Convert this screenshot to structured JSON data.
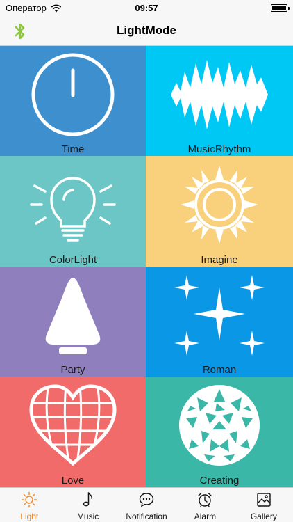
{
  "status_bar": {
    "carrier": "Оператор",
    "time": "09:57"
  },
  "nav": {
    "title": "LightMode",
    "bluetooth_color": "#8cc63f"
  },
  "modes": [
    {
      "label": "Time",
      "icon": "clock-icon",
      "color": "#3d8fce"
    },
    {
      "label": "MusicRhythm",
      "icon": "sound-wave-icon",
      "color": "#00c8f4"
    },
    {
      "label": "ColorLight",
      "icon": "light-bulb-icon",
      "color": "#6cc6c6"
    },
    {
      "label": "Imagine",
      "icon": "sun-icon",
      "color": "#f9d07b"
    },
    {
      "label": "Party",
      "icon": "lamp-icon",
      "color": "#8f80bd"
    },
    {
      "label": "Roman",
      "icon": "sparkles-icon",
      "color": "#0a97e6"
    },
    {
      "label": "Love",
      "icon": "heart-icon",
      "color": "#f16b6a"
    },
    {
      "label": "Creating",
      "icon": "disco-ball-icon",
      "color": "#3bb7a7"
    }
  ],
  "tabs": [
    {
      "label": "Light",
      "icon": "sun-icon",
      "active": true
    },
    {
      "label": "Music",
      "icon": "music-note-icon",
      "active": false
    },
    {
      "label": "Notification",
      "icon": "chat-bubble-icon",
      "active": false
    },
    {
      "label": "Alarm",
      "icon": "alarm-clock-icon",
      "active": false
    },
    {
      "label": "Gallery",
      "icon": "image-icon",
      "active": false
    }
  ],
  "active_tab_color": "#f08a2c"
}
